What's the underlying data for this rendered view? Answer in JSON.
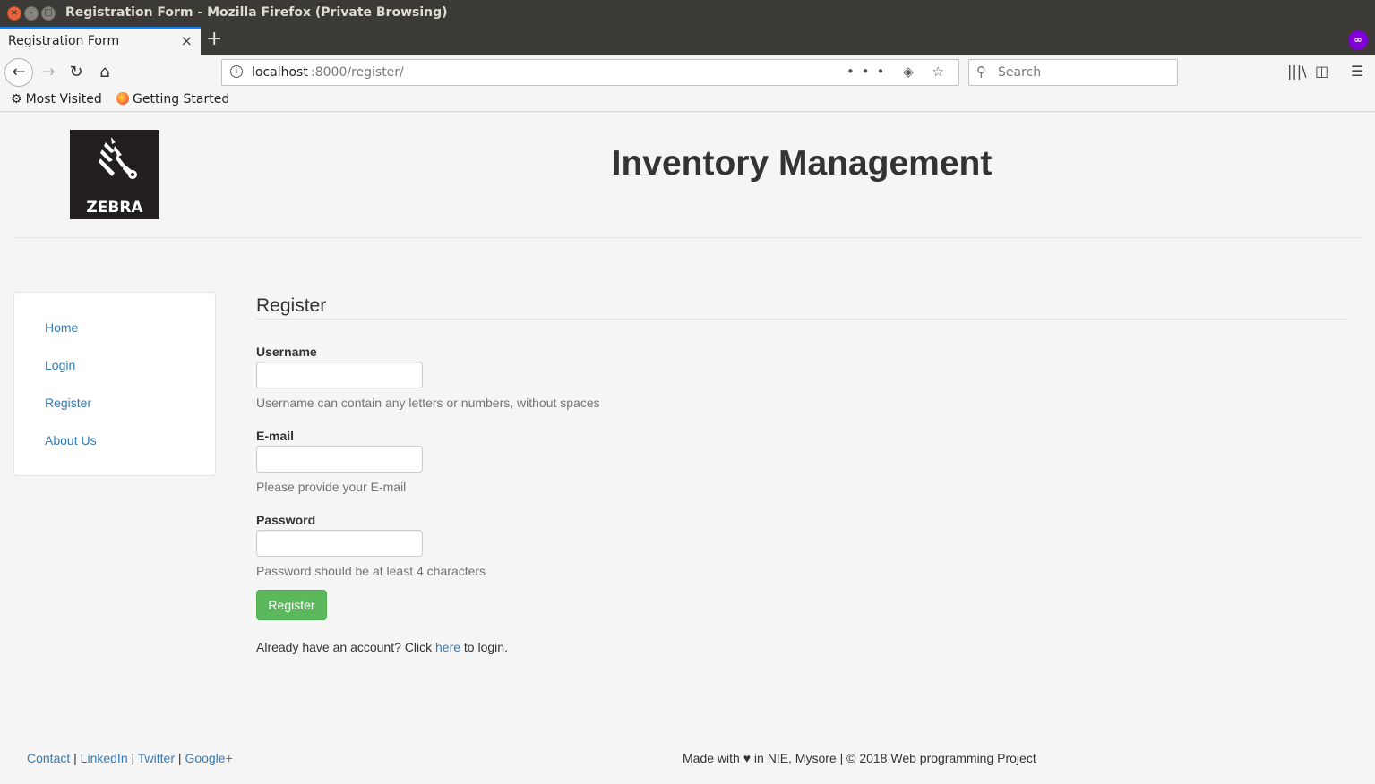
{
  "window": {
    "title": "Registration Form - Mozilla Firefox (Private Browsing)",
    "close_glyph": "×",
    "minimize_glyph": "–",
    "maximize_glyph": "□"
  },
  "tabs": [
    {
      "title": "Registration Form",
      "active": true
    }
  ],
  "tab_close_glyph": "×",
  "new_tab_glyph": "+",
  "private_icon_glyph": "∞",
  "toolbar": {
    "back_glyph": "←",
    "forward_glyph": "→",
    "reload_glyph": "↻",
    "home_glyph": "⌂",
    "library_glyph": "|||\\",
    "sidebar_glyph": "◫",
    "menu_glyph": "☰"
  },
  "urlbar": {
    "info_glyph": "i",
    "host": "localhost",
    "path": ":8000/register/",
    "actions": "••• ◈ ☆"
  },
  "search": {
    "icon_glyph": "⚲",
    "placeholder": "Search"
  },
  "bookmarks": [
    {
      "label": "Most Visited",
      "icon": "gear-icon",
      "glyph": "⚙"
    },
    {
      "label": "Getting Started",
      "icon": "firefox-icon"
    }
  ],
  "site": {
    "logo_text": "ZEBRA",
    "title": "Inventory Management"
  },
  "sidebar": {
    "items": [
      {
        "label": "Home"
      },
      {
        "label": "Login"
      },
      {
        "label": "Register"
      },
      {
        "label": "About Us"
      }
    ]
  },
  "form": {
    "title": "Register",
    "fields": [
      {
        "label": "Username",
        "value": "",
        "help": "Username can contain any letters or numbers, without spaces"
      },
      {
        "label": "E-mail",
        "value": "",
        "help": "Please provide your E-mail"
      },
      {
        "label": "Password",
        "value": "",
        "help": "Password should be at least 4 characters"
      }
    ],
    "submit_label": "Register",
    "login_prompt_before": "Already have an account? Click ",
    "login_link": "here",
    "login_prompt_after": " to login."
  },
  "footer": {
    "links": [
      "Contact",
      "LinkedIn",
      "Twitter",
      "Google+"
    ],
    "separator": " | ",
    "credit_before": "Made with ",
    "heart_glyph": "♥",
    "credit_after": " in NIE, Mysore | © 2018 Web programming Project"
  },
  "colors": {
    "link": "#337ab7",
    "success": "#5cb85c",
    "titlebar": "#3b3a36",
    "private_purple": "#8000d7"
  }
}
